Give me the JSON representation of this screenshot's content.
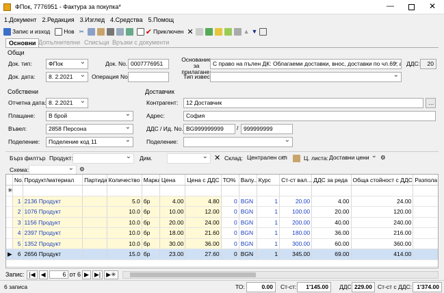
{
  "window": {
    "title": "ФПок, 7776951 - Фактура за покупка*"
  },
  "menu": [
    "1.Документ",
    "2.Редакция",
    "3.Изглед",
    "4.Средства",
    "5.Помощ"
  ],
  "toolbar": {
    "save_exit": "Запис и изход",
    "new": "Нов",
    "post": "Приключен"
  },
  "tabs": [
    "Основни",
    "Допълнителни",
    "Списъци",
    "Връзки с документи"
  ],
  "general": {
    "title": "Общи",
    "doc_type_label": "Док. тип:",
    "doc_type": "ФПок",
    "doc_no_label": "Док. No.",
    "doc_no": "0007776951",
    "basis_label": "Основание за прилагане:",
    "basis": "С право на пълен ДК: Облагаеми доставки, внос, доставки по чл.69, ал.2",
    "vat_label": "ДДС:",
    "vat": "20",
    "doc_date_label": "Док. дата:",
    "doc_date": "8. 2.2021",
    "op_no_label": "Операция No.",
    "op_no": "",
    "notice_label": "Тип известие:",
    "notice": ""
  },
  "own": {
    "title": "Собствени",
    "rep_date_label": "Отчетна дата:",
    "rep_date": "8. 2.2021",
    "payment_label": "Плащане:",
    "payment": "В брой",
    "entered_label": "Въвел:",
    "entered": "2858 Персона",
    "division_label": "Поделение:",
    "division": "Поделение код 11"
  },
  "supplier": {
    "title": "Доставчик",
    "contractor_label": "Контрагент:",
    "contractor": "12 Доставчик",
    "address_label": "Адрес:",
    "address": "София",
    "vat_id_label": "ДДС / Ид. No.",
    "vat_no": "BG999999999",
    "id_no": "999999999",
    "division_label": "Поделение:",
    "division": ""
  },
  "filter": {
    "quick": "Бърз филтър",
    "product_label": "Продукт:",
    "dim_label": "Дим.",
    "warehouse_label": "Склад:",
    "warehouse": "Централен скл",
    "price_list_label": "Ц. листа:",
    "price_list": "Доставни цени",
    "scheme_label": "Схема:"
  },
  "grid": {
    "columns": [
      "No.",
      "Продукт/материал",
      "Партида",
      "Количество",
      "Марка",
      "Цена",
      "Цена с ДДС",
      "ТО%",
      "Валу...",
      "Курс",
      "Ст-ст вал...",
      "ДДС за реда",
      "Обща стойност с ДДС",
      "Разпола"
    ],
    "rows": [
      [
        "1",
        "2136 Продукт",
        "",
        "5.0",
        "бр",
        "4.00",
        "4.80",
        "0",
        "BGN",
        "1",
        "20.00",
        "4.00",
        "24.00",
        ""
      ],
      [
        "2",
        "1076 Продукт",
        "",
        "10.0",
        "бр",
        "10.00",
        "12.00",
        "0",
        "BGN",
        "1",
        "100.00",
        "20.00",
        "120.00",
        ""
      ],
      [
        "3",
        "1156 Продукт",
        "",
        "10.0",
        "бр",
        "20.00",
        "24.00",
        "0",
        "BGN",
        "1",
        "200.00",
        "40.00",
        "240.00",
        ""
      ],
      [
        "4",
        "2397 Продукт",
        "",
        "10.0",
        "бр",
        "18.00",
        "21.60",
        "0",
        "BGN",
        "1",
        "180.00",
        "36.00",
        "216.00",
        ""
      ],
      [
        "5",
        "1352 Продукт",
        "",
        "10.0",
        "бр",
        "30.00",
        "36.00",
        "0",
        "BGN",
        "1",
        "300.00",
        "60.00",
        "360.00",
        ""
      ],
      [
        "6",
        "2656 Продукт",
        "",
        "15.0",
        "бр",
        "23.00",
        "27.60",
        "0",
        "BGN",
        "1",
        "345.00",
        "69.00",
        "414.00",
        ""
      ]
    ]
  },
  "nav": {
    "label": "Запис:",
    "current": "6",
    "of": "от 6"
  },
  "status": {
    "records": "6 записа",
    "to_label": "ТО:",
    "to": "0.00",
    "cost_label": "Ст-ст:",
    "cost": "1'145.00",
    "vat_label": "ДДС:",
    "vat": "229.00",
    "cost_vat_label": "Ст-ст с ДДС:",
    "cost_vat": "1'374.00"
  }
}
